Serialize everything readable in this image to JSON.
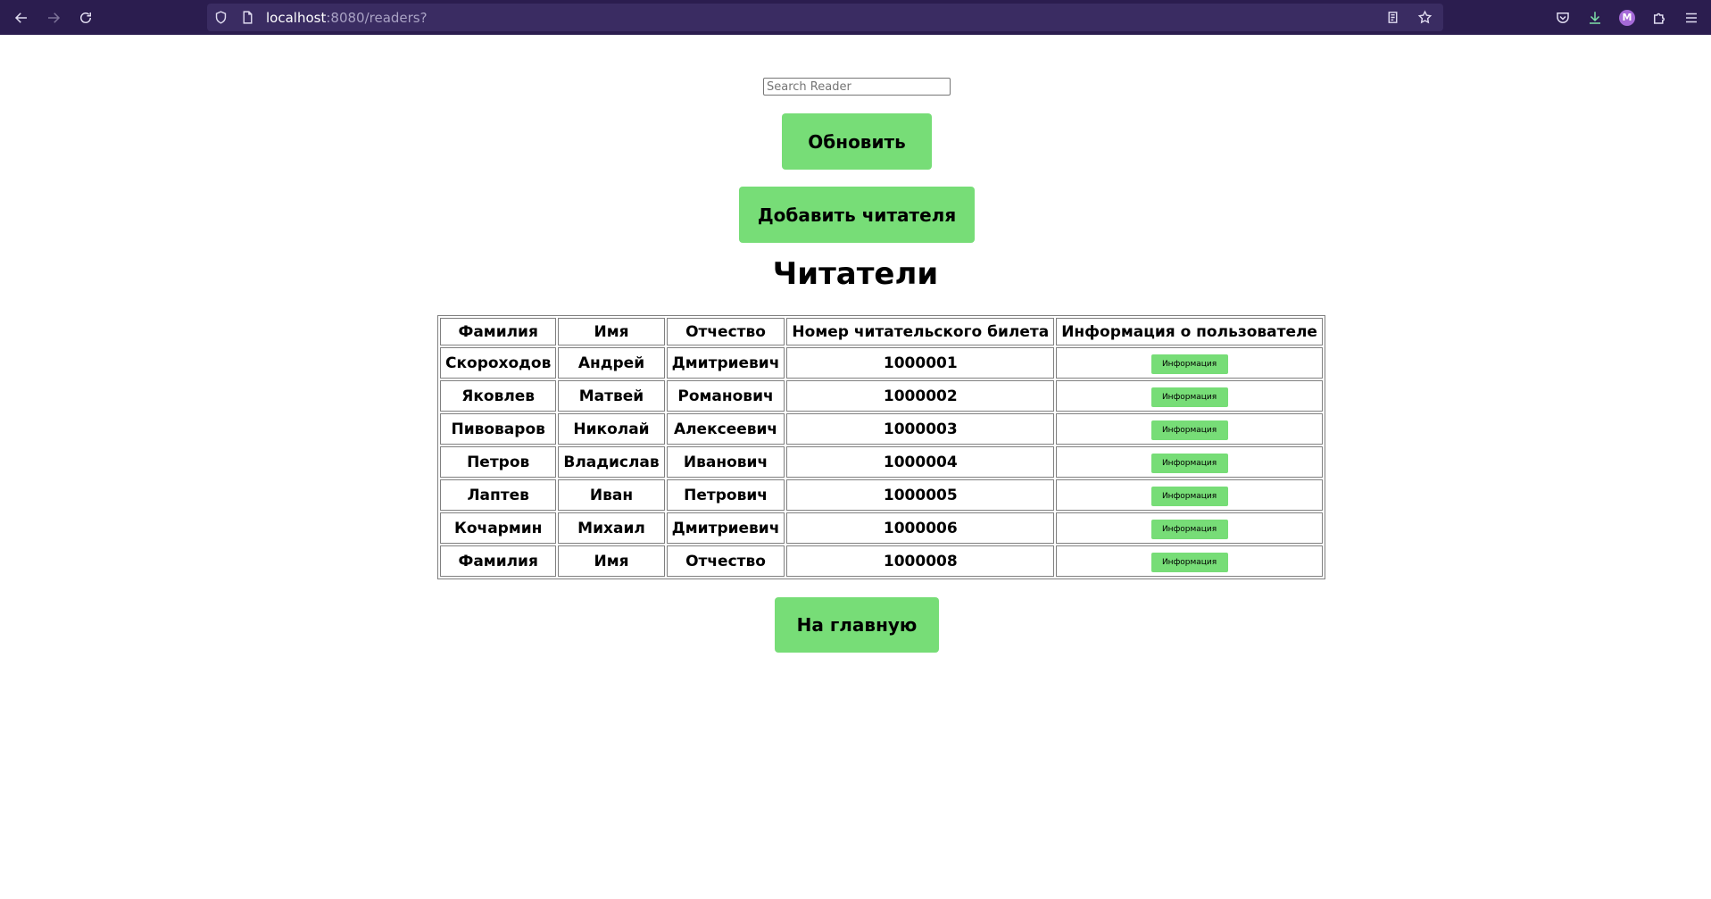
{
  "browser": {
    "url_host": "localhost",
    "url_rest": ":8080/readers?",
    "profile_initial": "M"
  },
  "search": {
    "placeholder": "Search Reader",
    "value": ""
  },
  "buttons": {
    "refresh": "Обновить",
    "add_reader": "Добавить читателя",
    "home": "На главную"
  },
  "page_title": "Читатели",
  "table": {
    "headers": [
      "Фамилия",
      "Имя",
      "Отчество",
      "Номер читательского билета",
      "Информация о пользователе"
    ],
    "info_button_label": "Информация",
    "rows": [
      [
        "Скороходов",
        "Андрей",
        "Дмитриевич",
        "1000001"
      ],
      [
        "Яковлев",
        "Матвей",
        "Романович",
        "1000002"
      ],
      [
        "Пивоваров",
        "Николай",
        "Алексеевич",
        "1000003"
      ],
      [
        "Петров",
        "Владислав",
        "Иванович",
        "1000004"
      ],
      [
        "Лаптев",
        "Иван",
        "Петрович",
        "1000005"
      ],
      [
        "Кочармин",
        "Михаил",
        "Дмитриевич",
        "1000006"
      ],
      [
        "Фамилия",
        "Имя",
        "Отчество",
        "1000008"
      ]
    ]
  },
  "colors": {
    "accent": "#77dd77",
    "chrome": "#2b1d4f"
  }
}
